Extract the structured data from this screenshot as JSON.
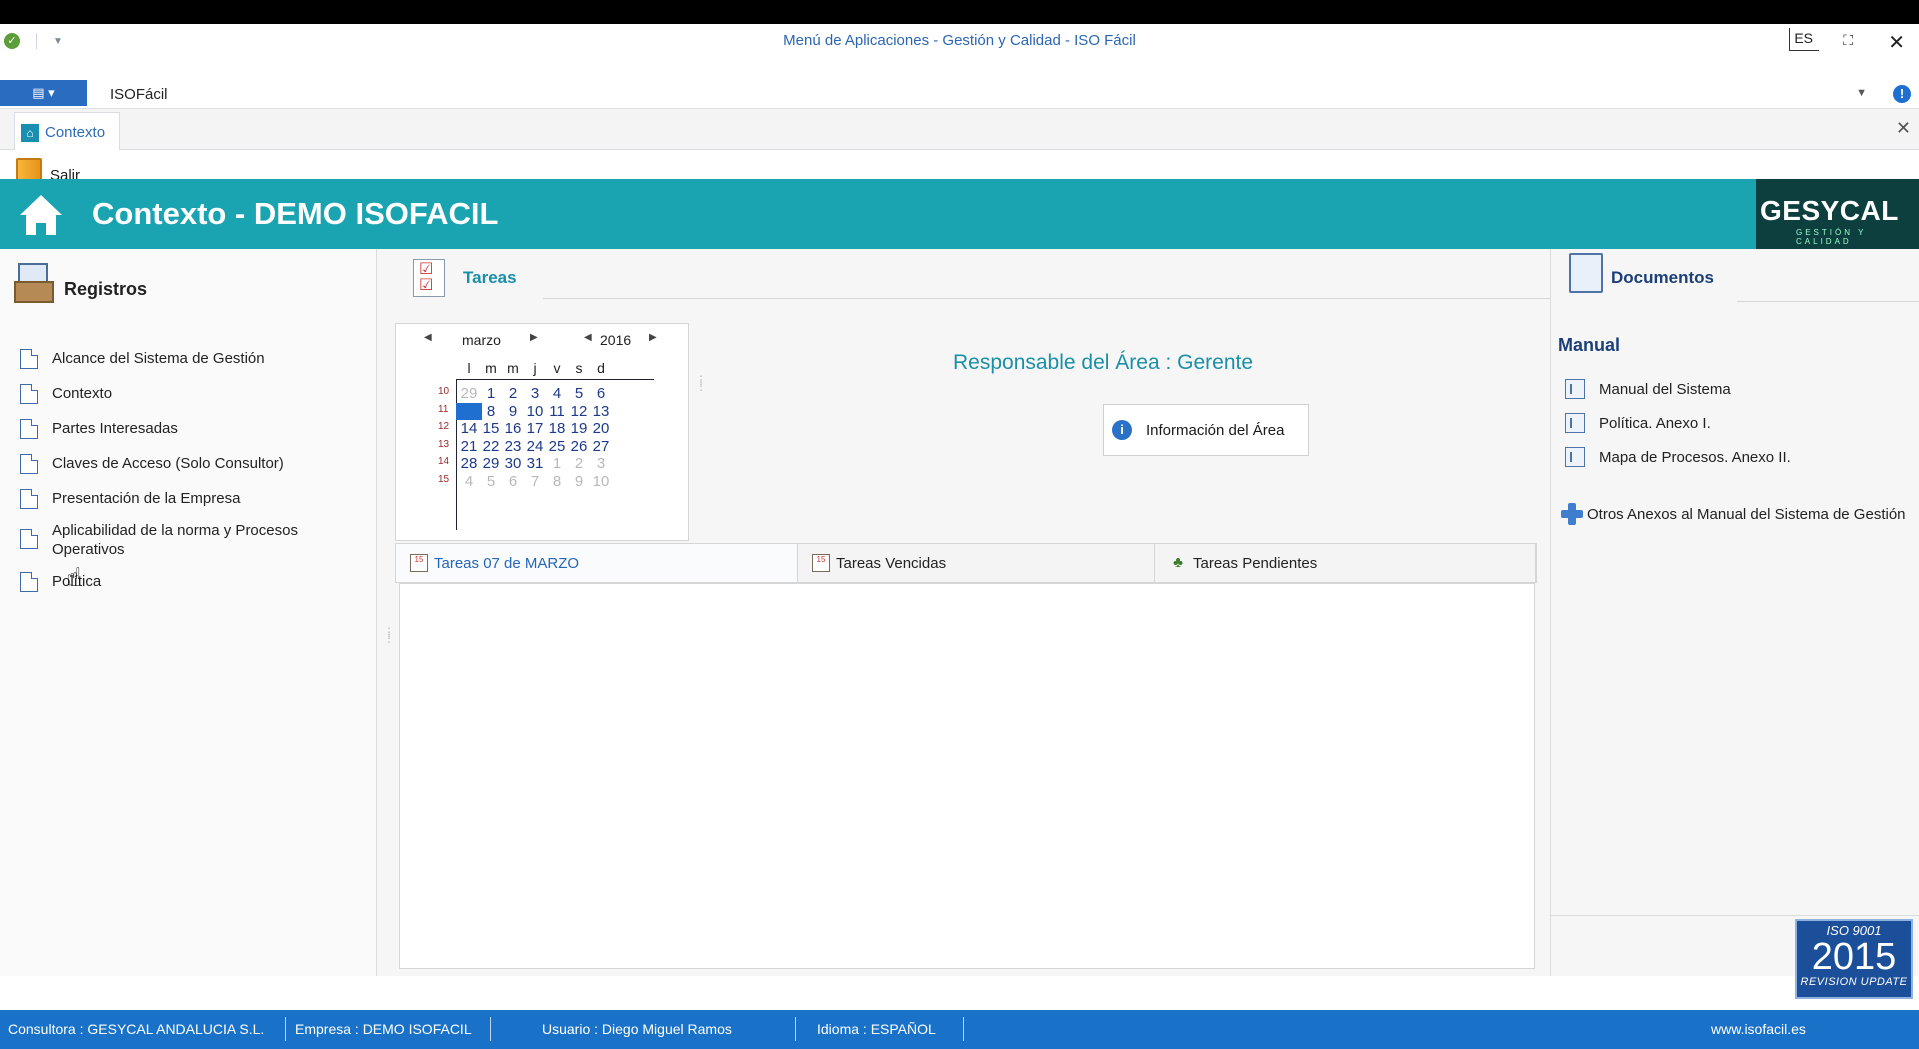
{
  "window": {
    "title": "Menú de Aplicaciones - Gestión y Calidad - ISO Fácil",
    "lang": "ES",
    "close_glyph": "✕"
  },
  "ribbon": {
    "app_tab": "ISOFácil"
  },
  "doc_tab": {
    "label": "Contexto"
  },
  "toolbar": {
    "salir_label": "Salir"
  },
  "header": {
    "title": "Contexto - DEMO ISOFACIL",
    "logo_text": "GESYCAL",
    "logo_sub": "GESTIÓN Y CALIDAD",
    "band_color": "#1aa3b0"
  },
  "registros": {
    "title": "Registros",
    "items": [
      "Alcance del Sistema de Gestión",
      "Contexto",
      "Partes Interesadas",
      "Claves de Acceso (Solo Consultor)",
      "Presentación de la Empresa",
      "Aplicabilidad de la norma y Procesos Operativos",
      "Política"
    ]
  },
  "tareas": {
    "title": "Tareas",
    "calendar": {
      "month": "marzo",
      "year": "2016",
      "weekdays": [
        "l",
        "m",
        "m",
        "j",
        "v",
        "s",
        "d"
      ],
      "weeks": [
        "10",
        "11",
        "12",
        "13",
        "14",
        "15"
      ],
      "rows": [
        [
          "29",
          "1",
          "2",
          "3",
          "4",
          "5",
          "6"
        ],
        [
          "7",
          "8",
          "9",
          "10",
          "11",
          "12",
          "13"
        ],
        [
          "14",
          "15",
          "16",
          "17",
          "18",
          "19",
          "20"
        ],
        [
          "21",
          "22",
          "23",
          "24",
          "25",
          "26",
          "27"
        ],
        [
          "28",
          "29",
          "30",
          "31",
          "1",
          "2",
          "3"
        ],
        [
          "4",
          "5",
          "6",
          "7",
          "8",
          "9",
          "10"
        ]
      ],
      "selected_day": "7"
    },
    "responsable": "Responsable del Área : Gerente",
    "info_button": "Información del Área",
    "tabs": [
      "Tareas 07 de MARZO",
      "Tareas Vencidas",
      "Tareas Pendientes"
    ]
  },
  "documentos": {
    "title": "Documentos",
    "manual_label": "Manual",
    "items": [
      "Manual del Sistema",
      "Política. Anexo I.",
      "Mapa de Procesos. Anexo II."
    ],
    "otros": "Otros Anexos al Manual del Sistema de Gestión",
    "badge": {
      "line1": "ISO 9001",
      "line2": "2015",
      "line3": "REVISION UPDATE"
    }
  },
  "status": {
    "consultora": "Consultora : GESYCAL ANDALUCIA S.L.",
    "empresa": "Empresa : DEMO ISOFACIL",
    "usuario": "Usuario : Diego Miguel Ramos",
    "idioma": "Idioma : ESPAÑOL",
    "web": "www.isofacil.es",
    "bar_color": "#1a72c8"
  }
}
